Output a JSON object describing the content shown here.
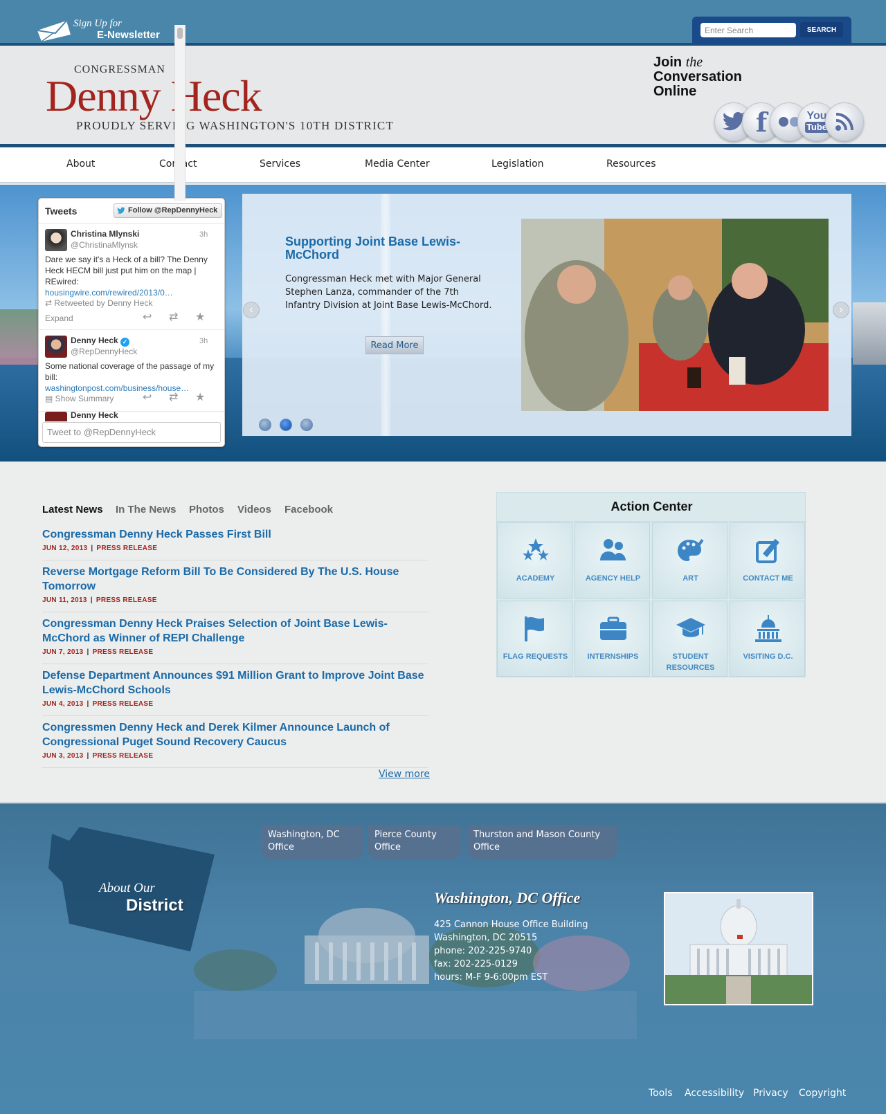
{
  "newsletter": {
    "line1": "Sign Up for",
    "line2": "E-Newsletter"
  },
  "search": {
    "placeholder": "Enter Search",
    "button": "SEARCH"
  },
  "logo": {
    "pre": "CONGRESSMAN",
    "name": "Denny Heck",
    "tagline": "PROUDLY SERVING WASHINGTON'S 10TH DISTRICT"
  },
  "join": {
    "word1": "Join",
    "word2": "the",
    "line2": "Conversation",
    "line3": "Online"
  },
  "social": [
    {
      "name": "twitter-icon"
    },
    {
      "name": "facebook-icon"
    },
    {
      "name": "flickr-icon"
    },
    {
      "name": "youtube-icon",
      "label1": "You",
      "label2": "Tube"
    },
    {
      "name": "rss-icon"
    }
  ],
  "nav": [
    "About",
    "Contact",
    "Services",
    "Media Center",
    "Legislation",
    "Resources"
  ],
  "tweets": {
    "title": "Tweets",
    "follow": "Follow @RepDennyHeck",
    "items": [
      {
        "name": "Christina Mlynski",
        "handle": "@ChristinaMlynsk",
        "time": "3h",
        "text": "Dare we say it's a Heck of a bill? The Denny Heck HECM bill just put him on the map | REwired:",
        "link": "housingwire.com/rewired/2013/0…",
        "retweet": "Retweeted by Denny Heck",
        "action": "Expand"
      },
      {
        "name": "Denny Heck",
        "handle": "@RepDennyHeck",
        "time": "3h",
        "text": "Some national coverage of the passage of my bill:",
        "link": "washingtonpost.com/business/house…",
        "action": "Show Summary"
      },
      {
        "name": "Denny Heck"
      }
    ],
    "input_placeholder": "Tweet to @RepDennyHeck"
  },
  "slider": {
    "title": "Supporting Joint Base Lewis-McChord",
    "text": "Congressman Heck met with Major General Stephen Lanza, commander of the 7th Infantry Division at Joint Base Lewis-McChord.",
    "button": "Read More",
    "active_dot": 2,
    "dot_count": 3
  },
  "news": {
    "tabs": [
      "Latest News",
      "In The News",
      "Photos",
      "Videos",
      "Facebook"
    ],
    "items": [
      {
        "title": "Congressman Denny Heck Passes First Bill",
        "date": "JUN 12, 2013",
        "type": "PRESS RELEASE"
      },
      {
        "title": "Reverse Mortgage Reform Bill To Be Considered By The U.S. House Tomorrow",
        "date": "JUN 11, 2013",
        "type": "PRESS RELEASE"
      },
      {
        "title": "Congressman Denny Heck Praises Selection of Joint Base Lewis-McChord as Winner of REPI Challenge",
        "date": "JUN 7, 2013",
        "type": "PRESS RELEASE"
      },
      {
        "title": "Defense Department Announces $91 Million Grant to Improve Joint Base Lewis-McChord Schools",
        "date": "JUN 4, 2013",
        "type": "PRESS RELEASE"
      },
      {
        "title": "Congressmen Denny Heck and Derek Kilmer Announce Launch of Congressional Puget Sound Recovery Caucus",
        "date": "JUN 3, 2013",
        "type": "PRESS RELEASE"
      }
    ],
    "view_more": "View more"
  },
  "action_center": {
    "title": "Action Center",
    "tiles": [
      "ACADEMY",
      "AGENCY HELP",
      "ART",
      "CONTACT ME",
      "FLAG REQUESTS",
      "INTERNSHIPS",
      "STUDENT RESOURCES",
      "VISITING D.C."
    ]
  },
  "footer": {
    "office_tabs": [
      "Washington, DC Office",
      "Pierce County Office",
      "Thurston and Mason County Office"
    ],
    "district": {
      "line1": "About Our",
      "line2": "District"
    },
    "office": {
      "heading": "Washington, DC Office",
      "lines": [
        "425 Cannon House Office Building",
        "Washington, DC 20515",
        "phone: 202-225-9740",
        "fax: 202-225-0129",
        "hours: M-F 9-6:00pm EST"
      ]
    },
    "links": [
      "Tools",
      "Accessibility",
      "Privacy",
      "Copyright"
    ]
  }
}
